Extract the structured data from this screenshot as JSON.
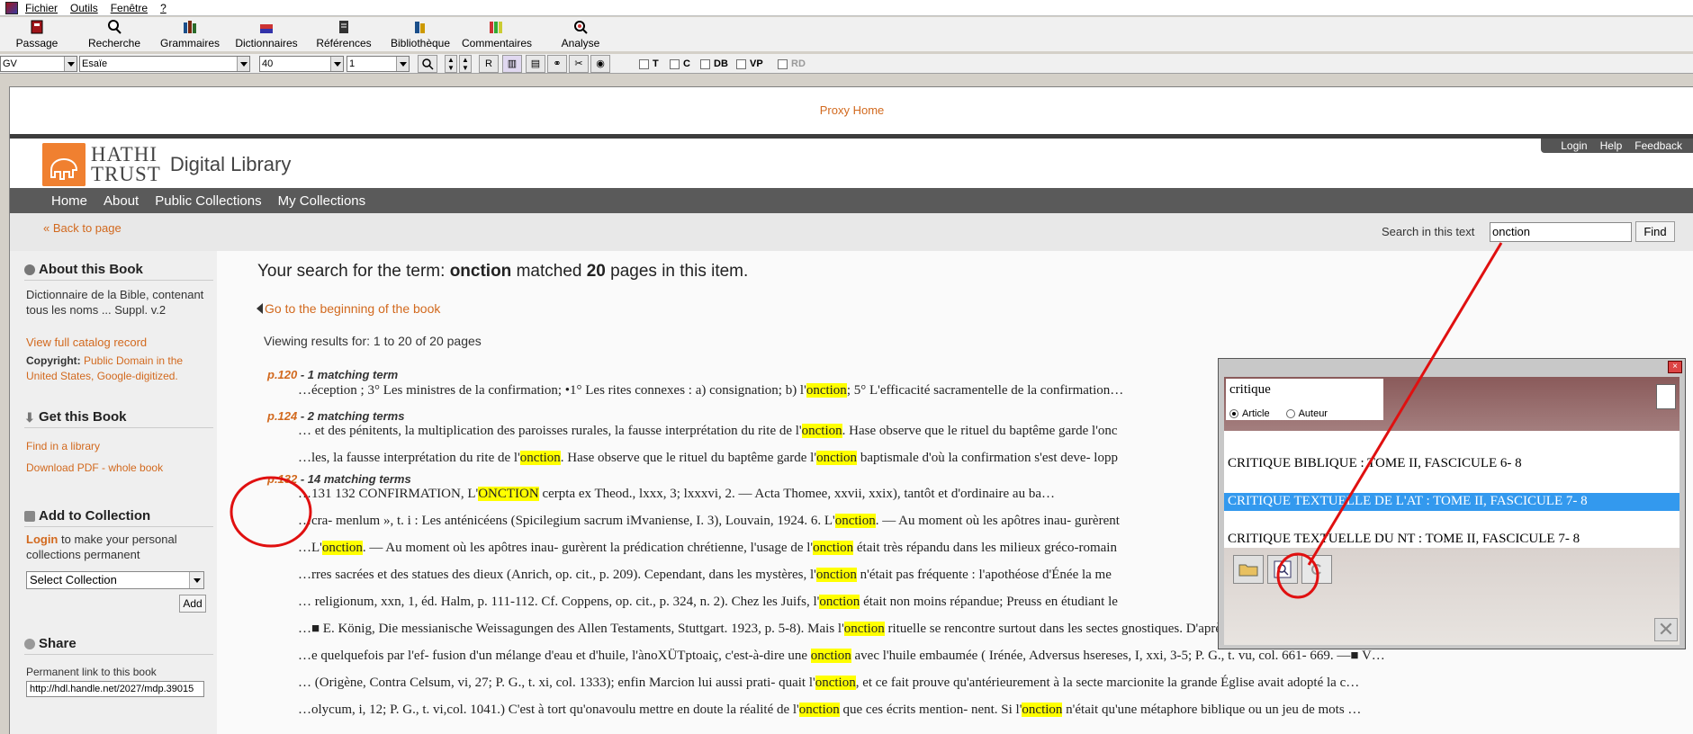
{
  "menubar": {
    "items": [
      "Fichier",
      "Outils",
      "Fenêtre",
      "?"
    ]
  },
  "toolbar": {
    "items": [
      {
        "label": "Passage",
        "icon": "passage-icon"
      },
      {
        "label": "Recherche",
        "icon": "search-icon"
      },
      {
        "label": "Grammaires",
        "icon": "grammar-icon"
      },
      {
        "label": "Dictionnaires",
        "icon": "dictionary-icon"
      },
      {
        "label": "Références",
        "icon": "references-icon"
      },
      {
        "label": "Bibliothèque",
        "icon": "library-icon"
      },
      {
        "label": "Commentaires",
        "icon": "comments-icon"
      },
      {
        "label": "Analyse",
        "icon": "analysis-icon"
      }
    ]
  },
  "combos": {
    "version": "GV",
    "book": "Esaïe",
    "chapter": "40",
    "verse": "1",
    "r_label": "R"
  },
  "checks": {
    "t": "T",
    "c": "C",
    "db": "DB",
    "vp": "VP",
    "rd": "RD"
  },
  "page": {
    "proxy": "Proxy Home",
    "toplinks": [
      "Login",
      "Help",
      "Feedback"
    ],
    "logo": {
      "line1": "HATHI",
      "line2": "TRUST",
      "sub": "Digital Library"
    },
    "nav": [
      "Home",
      "About",
      "Public Collections",
      "My Collections"
    ],
    "back": "« Back to page",
    "search_label": "Search in this text",
    "search_value": "onction",
    "find": "Find"
  },
  "sidebar": {
    "about_h": "About this Book",
    "about_t": "Dictionnaire de la Bible, contenant tous les noms ... Suppl. v.2",
    "catalog": "View full catalog record",
    "copyright_b": "Copyright:",
    "copyright_l": "Public Domain in the United States, Google-digitized.",
    "get_h": "Get this Book",
    "find_lib": "Find in a library",
    "download": "Download PDF - whole book",
    "add_h": "Add to Collection",
    "login": "Login",
    "login_t": " to make your personal collections permanent",
    "select": "Select Collection",
    "add": "Add",
    "share_h": "Share",
    "perm_lbl": "Permanent link to this book",
    "perm": "http://hdl.handle.net/2027/mdp.39015"
  },
  "main": {
    "t1": "Your search for the term: ",
    "term": "onction",
    "t2": " matched ",
    "count": "20",
    "t3": " pages in this item.",
    "goto": "Go to the beginning of the book",
    "viewing": "Viewing results for: 1 to 20 of 20 pages",
    "results": [
      {
        "p": "p.120",
        "t": " - 1 matching term"
      },
      {
        "p": "p.124",
        "t": " - 2 matching terms"
      },
      {
        "p": "p.132",
        "t": " - 14 matching terms"
      }
    ],
    "snippets": [
      [
        "…éception ; 3° Les ministres de la confirmation; •1° Les rites connexes : a) consignation; b) l'",
        "onction",
        "; 5° L'efficacité sacramentelle de la confirmation…"
      ],
      [
        "… et des pénitents, la multiplication des paroisses rurales, la fausse interprétation du rite de l'",
        "onction",
        ". Hase observe que le rituel du baptême garde l'onc"
      ],
      [
        "…les, la fausse interprétation du rite de l'",
        "onction",
        ". Hase observe que le rituel du baptême garde l'",
        "onction",
        " baptismale d'où la confirmation s'est deve- lopp"
      ],
      [
        "…131 132 CONFIRMATION, L'",
        "ONCTION",
        " cerpta ex Theod., lxxx, 3; lxxxvi, 2. — Acta Thomee, xxvii, xxix), tantôt et d'ordinaire au ba…"
      ],
      [
        "…cra- menlum », t. i : Les anténicéens (Spicilegium sacrum iMvaniense, I. 3), Louvain, 1924. 6. L'",
        "onction",
        ". — Au moment où les apôtres inau- gurèrent"
      ],
      [
        "…L'",
        "onction",
        ". — Au moment où les apôtres inau- gurèrent la prédication chrétienne, l'usage de l'",
        "onction",
        " était très répandu dans les milieux gréco-romain"
      ],
      [
        "…rres sacrées et des statues des dieux (Anrich, op. cit., p. 209). Cependant, dans les mystères, l'",
        "onction",
        " n'était pas fréquente : l'apothéose d'Énée la me"
      ],
      [
        "… religionum, xxn, 1, éd. Halm, p. 111-112. Cf. Coppens, op. cit., p. 324, n. 2). Chez les Juifs, l'",
        "onction",
        " était non moins répandue; Preuss en étudiant le"
      ],
      [
        "…■ E. König, Die messianische Weissagungen des Allen Testaments, Stuttgart. 1923, p. 5-8). Mais l'",
        "onction",
        " rituelle se rencontre surtout dans les sectes gnostiques. D'après saint Irénée, le baptême des …"
      ],
      [
        "…e quelquefois par l'ef- fusion d'un mélange d'eau et d'huile, l'ànoXÜTptoaiç, c'est-à-dire une ",
        "onction",
        " avec l'huile embaumée ( Irénée, Adversus hsereses, I, xxi, 3-5; P. G., t. vu, col. 661- 669. —■ V…"
      ],
      [
        "… (Origène, Contra Celsum, vi, 27; P. G., t. xi, col. 1333); enfin Marcion lui aussi prati- quait l'",
        "onction",
        ", et ce fait prouve qu'antérieurement à la secte marcionite la grande Église avait adopté la c…"
      ],
      [
        "…olycum, i, 12; P. G., t. vi,col. 1041.) C'est à tort qu'onavoulu mettre en doute la réalité de l'",
        "onction",
        " que ces écrits mention- nent. Si l'",
        "onction",
        " n'était qu'une métaphore biblique ou un jeu de mots …"
      ]
    ]
  },
  "popup": {
    "field": "critique",
    "radio1": "Article",
    "radio2": "Auteur",
    "items": [
      "CRITIQUE BIBLIQUE : TOME II, FASCICULE 6- 8",
      "CRITIQUE TEXTUELLE DE L'AT : TOME II, FASCICULE 7- 8",
      "CRITIQUE TEXTUELLE DU NT : TOME II, FASCICULE 7- 8"
    ]
  }
}
